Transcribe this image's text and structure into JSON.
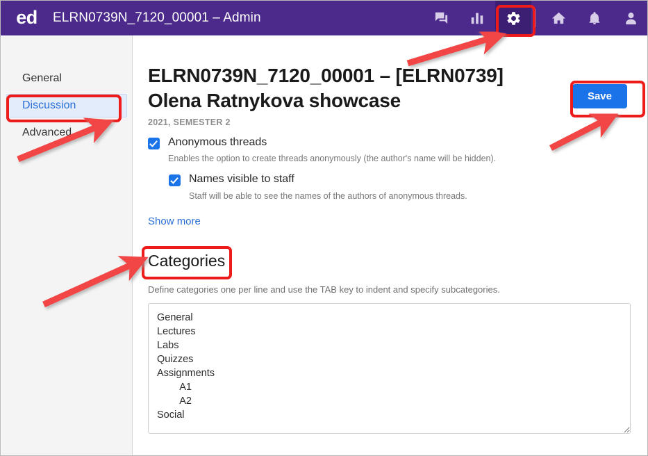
{
  "header": {
    "brand": "ed",
    "title": "ELRN0739N_7120_00001 – Admin",
    "icons": [
      {
        "name": "discussion-icon",
        "label": "Discussion"
      },
      {
        "name": "analytics-icon",
        "label": "Analytics"
      },
      {
        "name": "gear-icon",
        "label": "Settings"
      },
      {
        "name": "home-icon",
        "label": "Home"
      },
      {
        "name": "bell-icon",
        "label": "Notifications"
      },
      {
        "name": "user-avatar-icon",
        "label": "Account"
      }
    ],
    "active_icon": "gear-icon",
    "background_color": "#4b2a8c",
    "active_icon_background": "#3c1f73"
  },
  "sidebar": {
    "items": [
      {
        "label": "General",
        "selected": false
      },
      {
        "label": "Discussion",
        "selected": true
      },
      {
        "label": "Advanced",
        "selected": false
      }
    ],
    "selected_color": "#2a6fd6",
    "selected_background": "#e3ecfb"
  },
  "main": {
    "title": "ELRN0739N_7120_00001 – [ELRN0739] Olena Ratnykova showcase",
    "subtitle": "2021, SEMESTER 2",
    "save_label": "Save",
    "save_color": "#1a73e8",
    "options": [
      {
        "label": "Anonymous threads",
        "description": "Enables the option to create threads anonymously (the author's name will be hidden).",
        "checked": true,
        "nested": false
      },
      {
        "label": "Names visible to staff",
        "description": "Staff will be able to see the names of the authors of anonymous threads.",
        "checked": true,
        "nested": true
      }
    ],
    "show_more_label": "Show more",
    "categories": {
      "heading": "Categories",
      "description": "Define categories one per line and use the TAB key to indent and specify subcategories.",
      "value": "General\nLectures\nLabs\nQuizzes\nAssignments\n\tA1\n\tA2\nSocial"
    }
  },
  "annotations": {
    "color": "#ee1b1b",
    "boxes": [
      {
        "name": "gear-icon-highlight"
      },
      {
        "name": "discussion-sidebar-highlight"
      },
      {
        "name": "save-button-highlight"
      },
      {
        "name": "categories-heading-highlight"
      }
    ],
    "arrows": [
      {
        "name": "arrow-to-gear-icon"
      },
      {
        "name": "arrow-to-discussion"
      },
      {
        "name": "arrow-to-save-button"
      },
      {
        "name": "arrow-to-categories"
      }
    ]
  }
}
